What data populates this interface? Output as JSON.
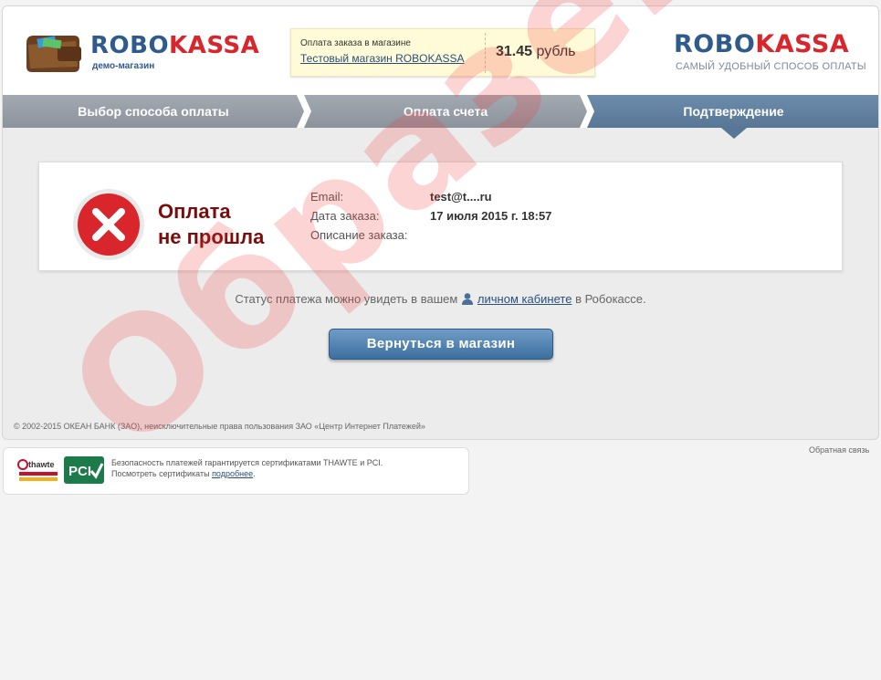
{
  "header": {
    "logo_left": {
      "robo": "ROBO",
      "kassa": "KASSA"
    },
    "demo_label": "демо-магазин",
    "logo_right": {
      "robo": "ROBO",
      "kassa": "KASSA"
    },
    "slogan": "САМЫЙ УДОБНЫЙ СПОСОБ ОПЛАТЫ",
    "order": {
      "label": "Оплата заказа в магазине",
      "shop": "Тестовый магазин ROBOKASSA",
      "amount": "31.45",
      "currency": "рубль"
    }
  },
  "steps": [
    {
      "label": "Выбор способа оплаты"
    },
    {
      "label": "Оплата счета"
    },
    {
      "label": "Подтверждение"
    }
  ],
  "result": {
    "title_line1": "Оплата",
    "title_line2": "не прошла",
    "rows": [
      {
        "key": "Email:",
        "value": "test@t....ru"
      },
      {
        "key": "Дата заказа:",
        "value": "17 июля 2015 г. 18:57"
      },
      {
        "key": "Описание заказа:",
        "value": ""
      }
    ]
  },
  "status": {
    "before": "Статус платежа можно увидеть в вашем",
    "link": "личном кабинете",
    "after": "в Робокассе."
  },
  "return_button": "Вернуться в магазин",
  "copyright": "© 2002-2015 ОКЕАН БАНК (ЗАО), неисключительные права пользования ЗАО «Центр Интернет Платежей»",
  "feedback": "Обратная связь",
  "cert": {
    "line1": "Безопасность платежей гарантируется сертификатами THAWTE и PCI.",
    "line2_before": "Посмотреть сертификаты",
    "line2_link": "подробнее",
    "thawte": "thawte",
    "pci": "PCI"
  },
  "watermark": "Образец",
  "colors": {
    "brand_blue": "#2f5a8c",
    "brand_red": "#d9262c",
    "error_red": "#d9262c",
    "fail_text": "#7a0c0c"
  }
}
